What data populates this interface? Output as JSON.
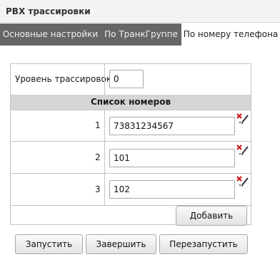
{
  "page": {
    "title": "PBX трассировки"
  },
  "tabs": [
    {
      "label": "Основные настройки"
    },
    {
      "label": "По ТранкГруппе"
    },
    {
      "label": "По номеру телефона"
    }
  ],
  "trace_level": {
    "label": "Уровень трассировок",
    "value": "0"
  },
  "numbers": {
    "header": "Список номеров",
    "rows": [
      {
        "index": "1",
        "value": "73831234567"
      },
      {
        "index": "2",
        "value": "101"
      },
      {
        "index": "3",
        "value": "102"
      }
    ],
    "delete_icon": "delete-pencil-icon"
  },
  "buttons": {
    "add": "Добавить",
    "start": "Запустить",
    "stop": "Завершить",
    "restart": "Перезапустить"
  },
  "colors": {
    "tab_inactive_bg": "#666666",
    "tab_active_bg": "#ffffff",
    "header_bg": "#d5d5d5",
    "delete_icon_red": "#cc1010"
  }
}
